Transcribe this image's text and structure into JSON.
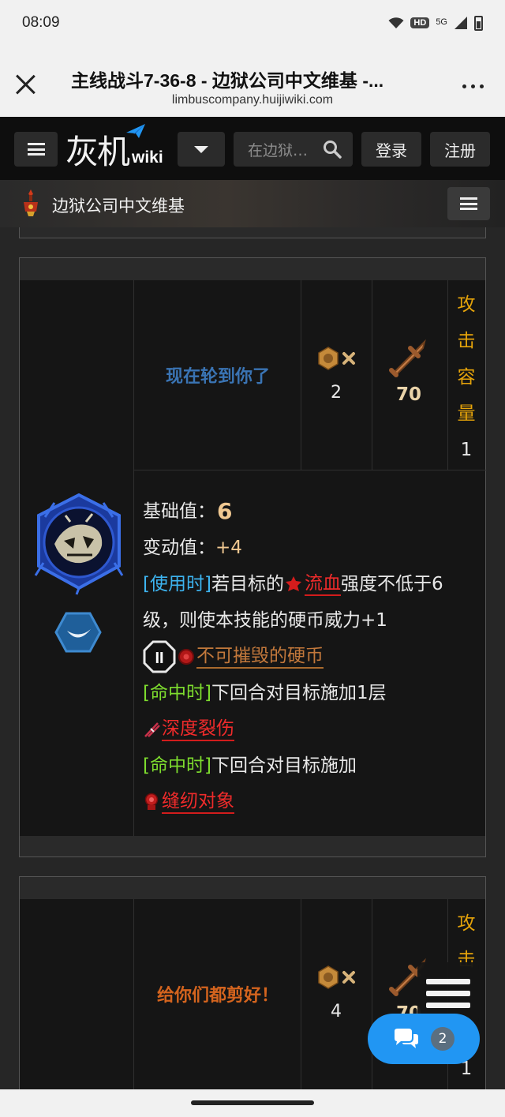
{
  "status_bar": {
    "time": "08:09",
    "hd": "HD",
    "network": "5G"
  },
  "browser": {
    "title": "主线战斗7-36-8 - 边狱公司中文维基 -...",
    "url": "limbuscompany.huijiwiki.com"
  },
  "site_nav": {
    "logo_cn": "灰机",
    "logo_wiki": "wiki",
    "search_placeholder": "在边狱…",
    "login": "登录",
    "register": "注册"
  },
  "sub_header": {
    "wiki_name": "边狱公司中文维基"
  },
  "skills": [
    {
      "name": "现在轮到你了",
      "name_color": "#3a74b4",
      "coin_count": "2",
      "attack_power": "70",
      "capacity_label": [
        "攻",
        "击",
        "容",
        "量"
      ],
      "capacity_value": "1",
      "base_label": "基础值：",
      "base_value": "6",
      "var_label": "变动值：",
      "var_value": "+4",
      "on_use_tag": "[使用时]",
      "on_use_text_1": "若目标的",
      "bleed_kw": "流血",
      "on_use_text_2": "强度不低于6",
      "on_use_text_3": "级，则使本技能的硬币威力+1",
      "unbreakable_kw": "不可摧毁的硬币",
      "coin_roman": "II",
      "on_hit_tag_1": "[命中时]",
      "on_hit_text_1": "下回合对目标施加1层",
      "laceration_kw": "深度裂伤",
      "on_hit_tag_2": "[命中时]",
      "on_hit_text_2": "下回合对目标施加",
      "sewn_kw": "缝纫对象"
    },
    {
      "name": "给你们都剪好！",
      "name_color": "#d4641e",
      "coin_count": "4",
      "attack_power": "70",
      "capacity_label": [
        "攻",
        "击"
      ],
      "capacity_value": "1"
    }
  ],
  "floating": {
    "chat_count": "2"
  },
  "colors": {
    "accent_blue": "#2196f3",
    "capacity_orange": "#e6a40a",
    "keyword_red": "#ef2b2b",
    "tag_blue": "#3db4f0",
    "tag_green": "#7ddc2e"
  }
}
